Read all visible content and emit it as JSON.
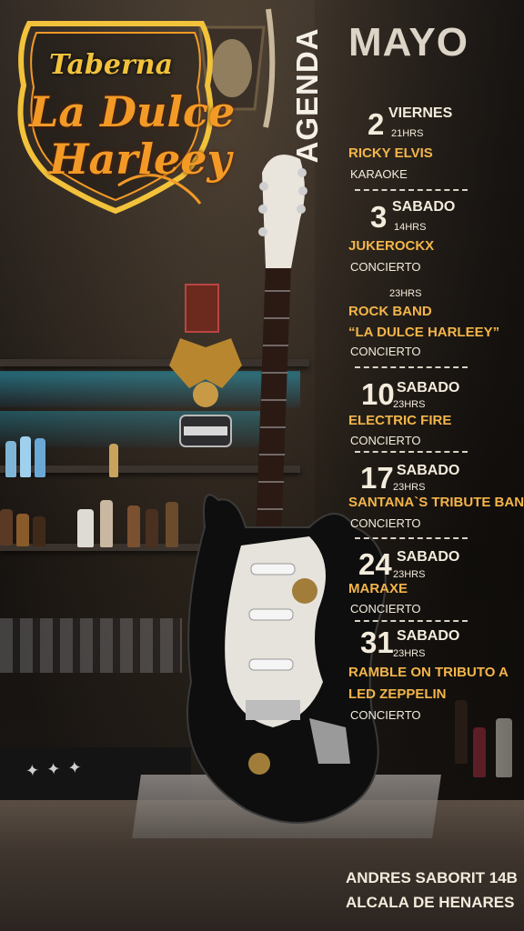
{
  "logo": {
    "line1": "Taberna",
    "line2": "La Dulce",
    "line3": "Harleey",
    "colors": {
      "gold": "#f2c23b",
      "orange": "#f39a26"
    }
  },
  "agenda_label": "AGENDA",
  "month": "MAYO",
  "events": [
    {
      "day_num": "2",
      "day_name": "VIERNES",
      "time": "21HRS",
      "name": "RICKY ELVIS",
      "type": "KARAOKE"
    },
    {
      "day_num": "3",
      "day_name": "SABADO",
      "time": "14HRS",
      "name": "JUKEROCKX",
      "type": "CONCIERTO"
    },
    {
      "time": "23HRS",
      "name_line1": "ROCK BAND",
      "name_line2": "“LA DULCE HARLEEY”",
      "type": "CONCIERTO"
    },
    {
      "day_num": "10",
      "day_name": "SABADO",
      "time": "23HRS",
      "name": "ELECTRIC FIRE",
      "type": "CONCIERTO"
    },
    {
      "day_num": "17",
      "day_name": "SABADO",
      "time": "23HRS",
      "name": "SANTANA`S TRIBUTE BAND",
      "type": "CONCIERTO"
    },
    {
      "day_num": "24",
      "day_name": "SABADO",
      "time": "23HRS",
      "name": "MARAXE",
      "type": "CONCIERTO"
    },
    {
      "day_num": "31",
      "day_name": "SABADO",
      "time": "23HRS",
      "name_line1": "RAMBLE ON TRIBUTO A",
      "name_line2": "LED ZEPPELIN",
      "type": "CONCIERTO"
    }
  ],
  "address": {
    "line1": "ANDRES SABORIT 14B",
    "line2": "ALCALA DE HENARES"
  },
  "colors": {
    "accent": "#f3b54a",
    "text": "#f3ecdc"
  }
}
